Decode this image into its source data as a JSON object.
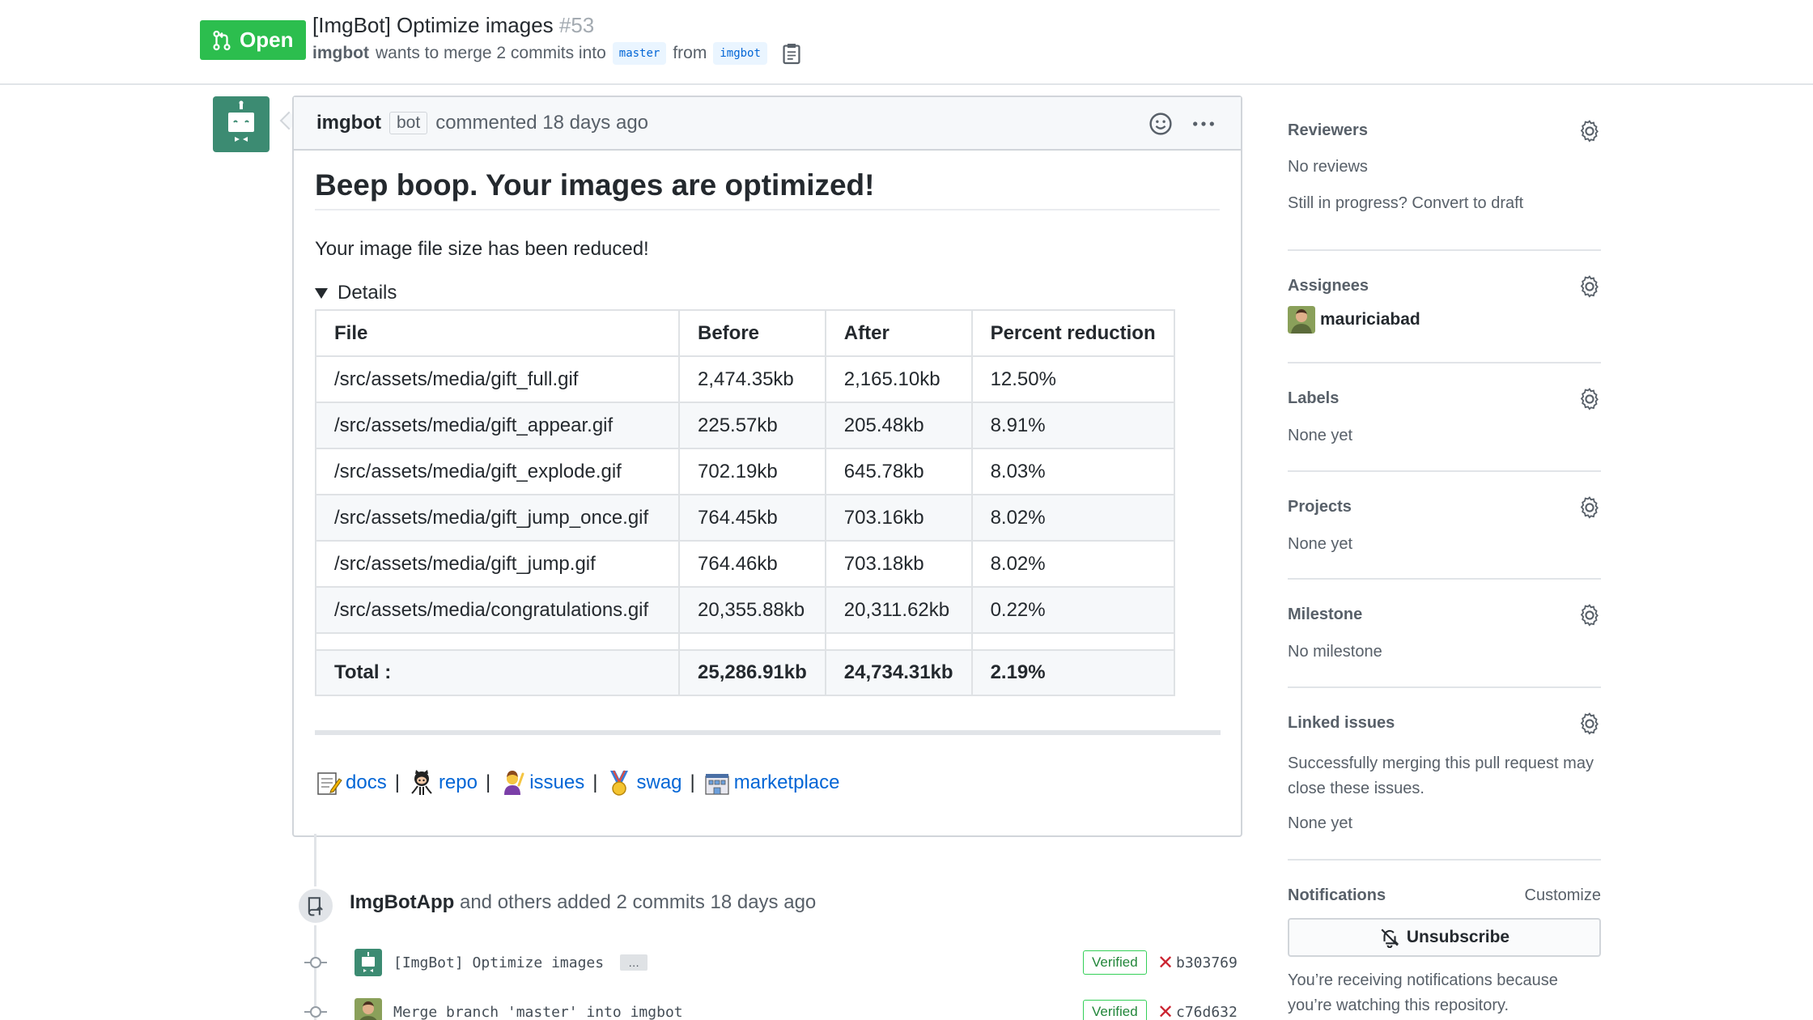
{
  "header": {
    "state_label": "Open",
    "title": "[ImgBot] Optimize images",
    "number": "#53",
    "meta_author": "imgbot",
    "meta_text_1": "wants to merge 2 commits into",
    "base_branch": "master",
    "meta_text_2": "from",
    "head_branch": "imgbot"
  },
  "comment": {
    "author": "imgbot",
    "author_label": "bot",
    "action_text": "commented 18 days ago",
    "heading": "Beep boop. Your images are optimized!",
    "paragraph": "Your image file size has been reduced!",
    "details_label": "Details",
    "table": {
      "headers": [
        "File",
        "Before",
        "After",
        "Percent reduction"
      ],
      "rows": [
        [
          "/src/assets/media/gift_full.gif",
          "2,474.35kb",
          "2,165.10kb",
          "12.50%"
        ],
        [
          "/src/assets/media/gift_appear.gif",
          "225.57kb",
          "205.48kb",
          "8.91%"
        ],
        [
          "/src/assets/media/gift_explode.gif",
          "702.19kb",
          "645.78kb",
          "8.03%"
        ],
        [
          "/src/assets/media/gift_jump_once.gif",
          "764.45kb",
          "703.16kb",
          "8.02%"
        ],
        [
          "/src/assets/media/gift_jump.gif",
          "764.46kb",
          "703.18kb",
          "8.02%"
        ],
        [
          "/src/assets/media/congratulations.gif",
          "20,355.88kb",
          "20,311.62kb",
          "0.22%"
        ]
      ],
      "total": [
        "Total :",
        "25,286.91kb",
        "24,734.31kb",
        "2.19%"
      ]
    },
    "links": {
      "docs": "docs",
      "repo": "repo",
      "issues": "issues",
      "swag": "swag",
      "marketplace": "marketplace",
      "separator": "|"
    }
  },
  "timeline": {
    "event_actor": "ImgBotApp",
    "event_text": "and others added 2 commits 18 days ago",
    "commits": [
      {
        "message": "[ImgBot] Optimize images",
        "verified": "Verified",
        "sha": "b303769",
        "ellipsis": "…"
      },
      {
        "message": "Merge branch 'master' into imgbot",
        "verified": "Verified",
        "sha": "c76d632"
      }
    ]
  },
  "sidebar": {
    "reviewers": {
      "title": "Reviewers",
      "value": "No reviews",
      "extra": "Still in progress? Convert to draft"
    },
    "assignees": {
      "title": "Assignees",
      "user": "mauriciabad"
    },
    "labels": {
      "title": "Labels",
      "value": "None yet"
    },
    "projects": {
      "title": "Projects",
      "value": "None yet"
    },
    "milestone": {
      "title": "Milestone",
      "value": "No milestone"
    },
    "linked_issues": {
      "title": "Linked issues",
      "desc": "Successfully merging this pull request may close these issues.",
      "value": "None yet"
    },
    "notifications": {
      "title": "Notifications",
      "customize": "Customize",
      "button": "Unsubscribe",
      "desc": "You’re receiving notifications because you’re watching this repository."
    }
  },
  "colors": {
    "open_green": "#2cbe4e",
    "link_blue": "#0366d6",
    "bot_avatar": "#3c8b72",
    "fail_red": "#cb2431"
  }
}
